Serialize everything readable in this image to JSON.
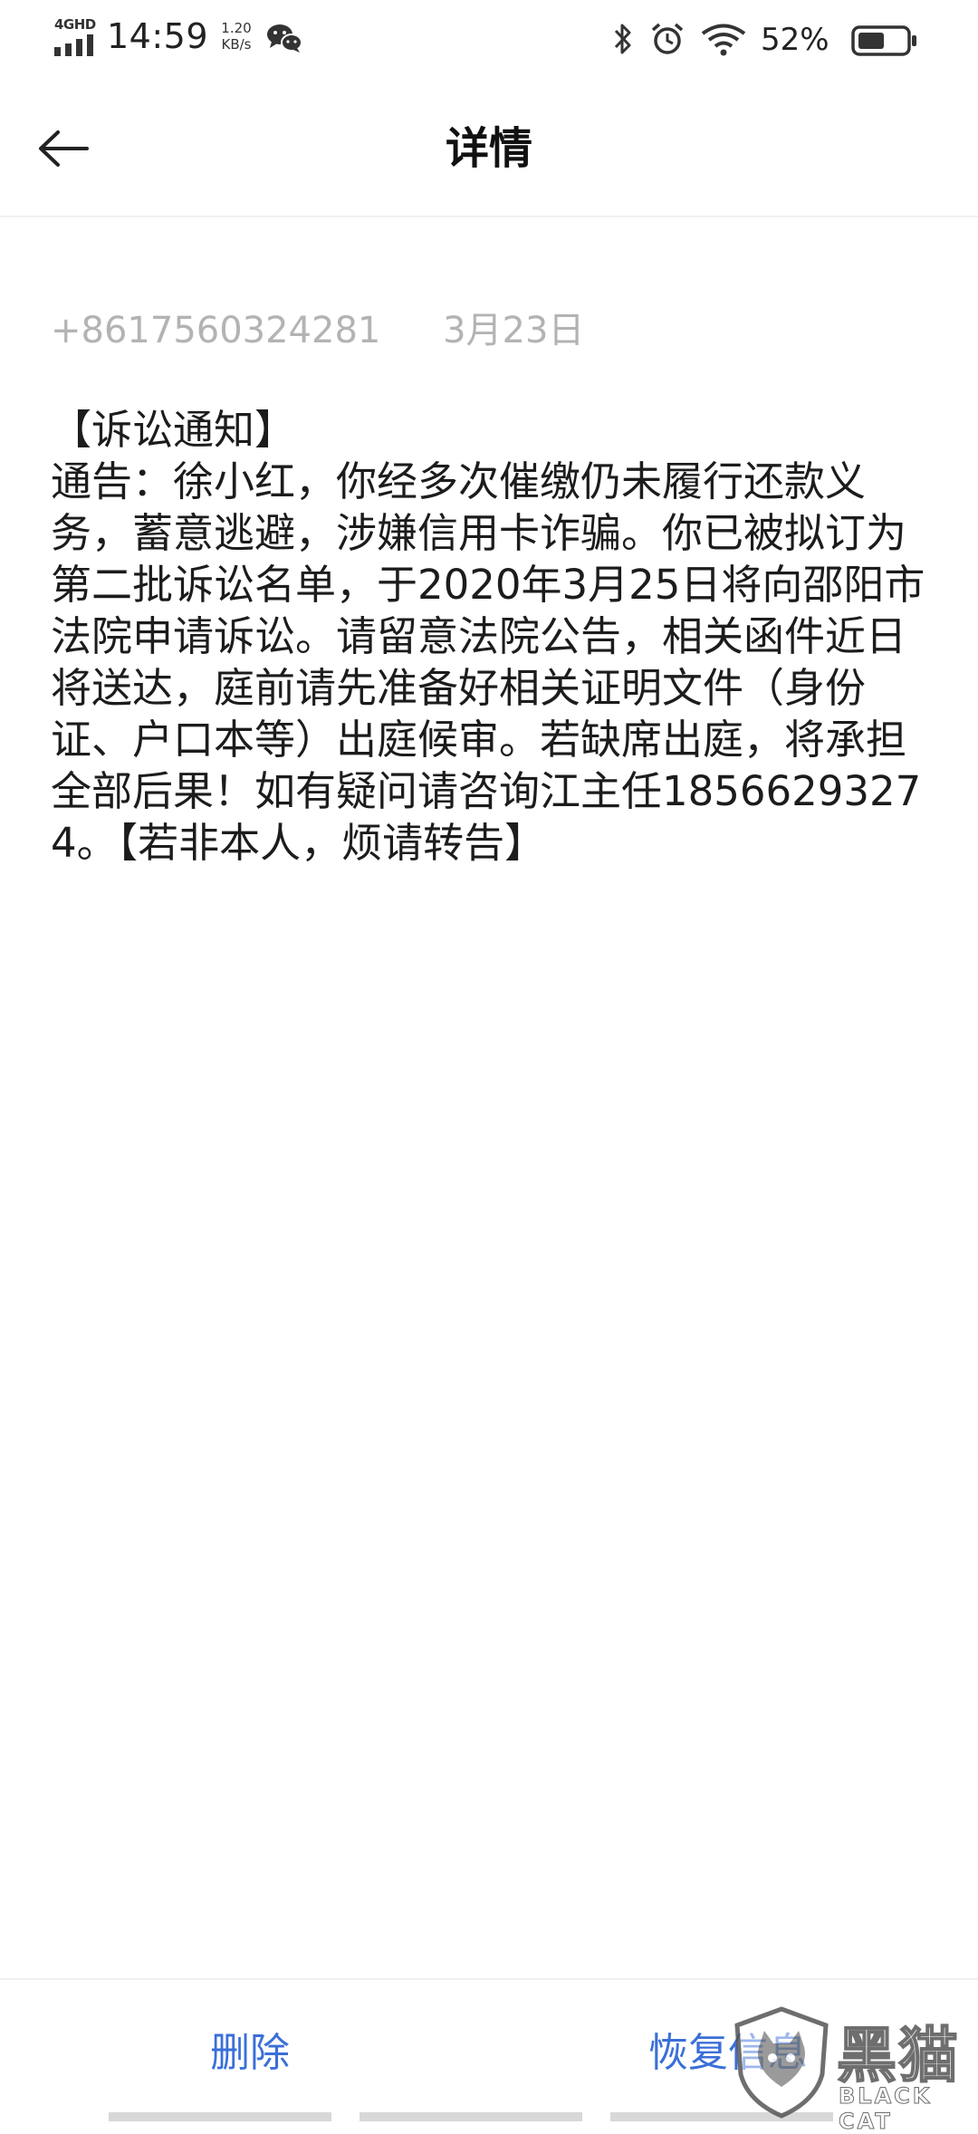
{
  "status_bar": {
    "network_type": "4GHD",
    "time": "14:59",
    "net_speed_value": "1.20",
    "net_speed_unit": "KB/s",
    "battery_percent": "52%"
  },
  "header": {
    "title": "详情"
  },
  "message": {
    "sender": "+8617560324281",
    "date": "3月23日",
    "body": "【诉讼通知】\n通告：徐小红，你经多次催缴仍未履行还款义务，蓄意逃避，涉嫌信用卡诈骗。你已被拟订为第二批诉讼名单，于2020年3月25日将向邵阳市法院申请诉讼。请留意法院公告，相关函件近日将送达，庭前请先准备好相关证明文件（身份证、户口本等）出庭候审。若缺席出庭，将承担全部后果！如有疑问请咨询江主任18566293274。【若非本人，烦请转告】"
  },
  "actions": {
    "delete_label": "删除",
    "restore_label": "恢复信息"
  },
  "watermark": {
    "main_text": "黑猫",
    "sub_text": "BLACK CAT"
  },
  "colors": {
    "accent": "#3a6fd8",
    "meta_text": "#b3b3b3",
    "body_text": "#1c1c1c"
  },
  "icons": {
    "back": "arrow-left-icon",
    "signal": "signal-bars-icon",
    "wechat": "wechat-icon",
    "bluetooth": "bluetooth-icon",
    "alarm": "alarm-clock-icon",
    "wifi": "wifi-icon",
    "battery": "battery-icon"
  }
}
